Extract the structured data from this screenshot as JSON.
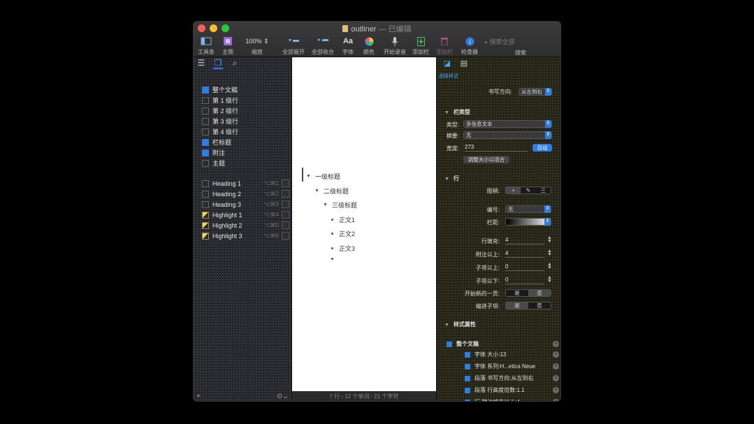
{
  "window": {
    "title": "outliner",
    "separator": "—",
    "edited": "已编辑",
    "colors": {
      "close": "#ff5f57",
      "minimize": "#febc2e",
      "zoom": "#28c840",
      "accent": "#2f7de1"
    }
  },
  "toolbar": {
    "items": [
      {
        "label": "工具条",
        "icon": "sidebar-icon"
      },
      {
        "label": "主题",
        "icon": "theme-icon"
      },
      {
        "label": "缩放",
        "icon": "zoom-value",
        "value": "100%"
      },
      {
        "label": "全部展开",
        "icon": "expand-all-icon"
      },
      {
        "label": "全部收合",
        "icon": "collapse-all-icon"
      },
      {
        "label": "字体",
        "icon": "font-icon",
        "glyph": "Aa"
      },
      {
        "label": "颜色",
        "icon": "color-wheel-icon"
      },
      {
        "label": "开始录音",
        "icon": "microphone-icon"
      },
      {
        "label": "添加栏",
        "icon": "add-column-icon"
      },
      {
        "label": "添加栏",
        "icon": "trash-icon"
      },
      {
        "label": "检查器",
        "icon": "info-icon"
      }
    ],
    "search_placeholder": "搜索全部",
    "search_label": "搜索"
  },
  "sidebar": {
    "styles": [
      {
        "label": "整个文稿",
        "state": "on"
      },
      {
        "label": "第 1 级行",
        "state": "off"
      },
      {
        "label": "第 2 级行",
        "state": "off"
      },
      {
        "label": "第 3 级行",
        "state": "off"
      },
      {
        "label": "第 4 级行",
        "state": "off"
      },
      {
        "label": "栏标题",
        "state": "on"
      },
      {
        "label": "附注",
        "state": "on"
      },
      {
        "label": "主题",
        "state": "off"
      }
    ],
    "named_styles": [
      {
        "label": "Heading 1",
        "num": "⌥⌘1",
        "state": "off"
      },
      {
        "label": "Heading 2",
        "num": "⌥⌘2",
        "state": "off"
      },
      {
        "label": "Heading 3",
        "num": "⌥⌘3",
        "state": "off"
      },
      {
        "label": "Highlight 1",
        "num": "⌥⌘4",
        "state": "hl"
      },
      {
        "label": "Highlight 2",
        "num": "⌥⌘5",
        "state": "hl"
      },
      {
        "label": "Highlight 3",
        "num": "⌥⌘6",
        "state": "hl"
      }
    ],
    "add_label": "+",
    "gear_label": "⊙⌄"
  },
  "outline": {
    "level1": "一级标题",
    "level2": "二级标题",
    "level3": "三级标题",
    "body": [
      "正文1",
      "正文2",
      "正文3"
    ],
    "status": "7 行 - 12 个单词 - 21 个字符"
  },
  "inspector": {
    "tab_label": "选择样式",
    "writing_direction_label": "书写方向:",
    "writing_direction_value": "从左到右",
    "column_type_section": "栏类型",
    "type_label": "类型:",
    "type_value": "多信息文本",
    "summary_label": "摘要:",
    "summary_value": "无",
    "width_label": "宽度:",
    "width_value": "273",
    "auto_button": "自动",
    "fit_button": "调整大小以适合",
    "row_section": "行",
    "handle_label": "图柄:",
    "handle_options": [
      "•",
      "✎",
      "三"
    ],
    "numbering_label": "编号:",
    "numbering_value": "无",
    "column_label": "栏距:",
    "row_padding_label": "行填充:",
    "row_padding_value": "4",
    "above_note_label": "附注以上:",
    "above_note_value": "4",
    "above_child_label": "子项以上:",
    "above_child_value": "0",
    "below_child_label": "子项以下:",
    "below_child_value": "0",
    "new_page_label": "开始新的一页:",
    "new_page_options": [
      "是",
      "否"
    ],
    "indent_children_label": "缩进子项:",
    "indent_children_options": [
      "是",
      "否"
    ],
    "style_attrs_section": "样式属性",
    "style_attrs_root": "整个文稿",
    "style_attrs": [
      "字体 大小:13",
      "字体 系列:H...etica Neue",
      "段落 书写方向:从左到右",
      "段落 行高度倍数:1.1",
      "行 附注填充以上:4"
    ]
  }
}
